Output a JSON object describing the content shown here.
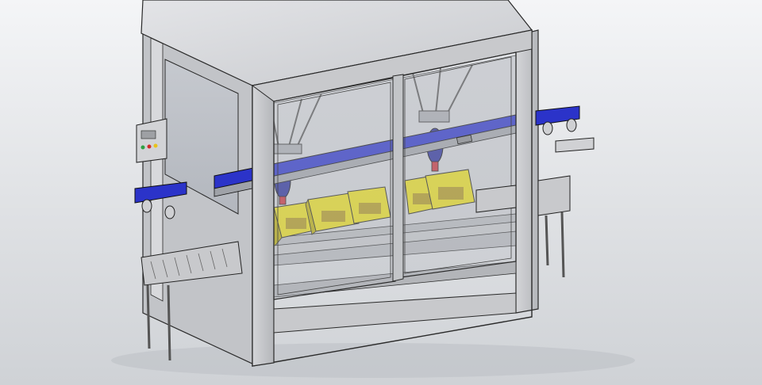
{
  "scene": {
    "subject": "machine",
    "colors": {
      "background_top": "#f4f5f7",
      "background_bottom": "#cfd2d6",
      "frame": "#c9cacd",
      "frame_shadow": "#8f9196",
      "roof": "#d6d7da",
      "glass": "#bfc2c8",
      "belt": "#2b33c9",
      "robot_gripper": "#2a2f9a",
      "suction_cup": "#c8323c",
      "box": "#e8dc1f",
      "box_side": "#b9ad0d",
      "box_print": "#8a6a22",
      "button_green": "#2ea043",
      "button_red": "#d12b2b",
      "button_yellow": "#e8c21a",
      "outline": "#2a2a2a"
    },
    "boxes": [
      {
        "id": "box-1"
      },
      {
        "id": "box-2"
      },
      {
        "id": "box-3"
      },
      {
        "id": "box-4"
      },
      {
        "id": "box-5"
      },
      {
        "id": "box-6"
      }
    ],
    "robots": [
      {
        "id": "robot-left"
      },
      {
        "id": "robot-right"
      }
    ],
    "control_panel": {
      "buttons": [
        "green",
        "red",
        "yellow"
      ]
    }
  }
}
